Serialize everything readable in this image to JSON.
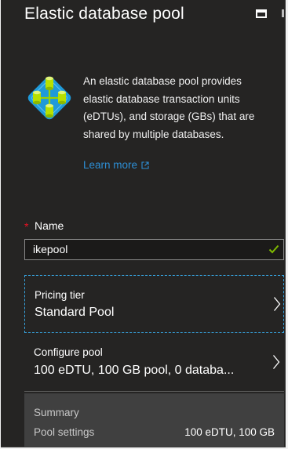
{
  "blade": {
    "title": "Elastic database pool",
    "icons": {
      "maximize": "maximize-icon",
      "logo": "elastic-pool-logo"
    }
  },
  "intro": {
    "description": "An elastic database pool provides elastic database transaction units (eDTUs), and storage (GBs) that are shared by multiple databases.",
    "learn_more": "Learn more"
  },
  "name_field": {
    "required_mark": "*",
    "label": "Name",
    "value": "ikepool"
  },
  "pricing_tier": {
    "label": "Pricing tier",
    "value": "Standard Pool"
  },
  "configure_pool": {
    "label": "Configure pool",
    "value": "100 eDTU, 100 GB pool, 0 databa..."
  },
  "summary": {
    "title": "Summary",
    "rows": [
      {
        "key": "Pool settings",
        "value": "100 eDTU, 100 GB"
      }
    ]
  },
  "colors": {
    "background": "#252423",
    "accent": "#2d8fd6",
    "selection_border": "#37a4e0",
    "valid_check": "#7fba00",
    "required": "#e81123",
    "summary_bg": "#404040"
  }
}
